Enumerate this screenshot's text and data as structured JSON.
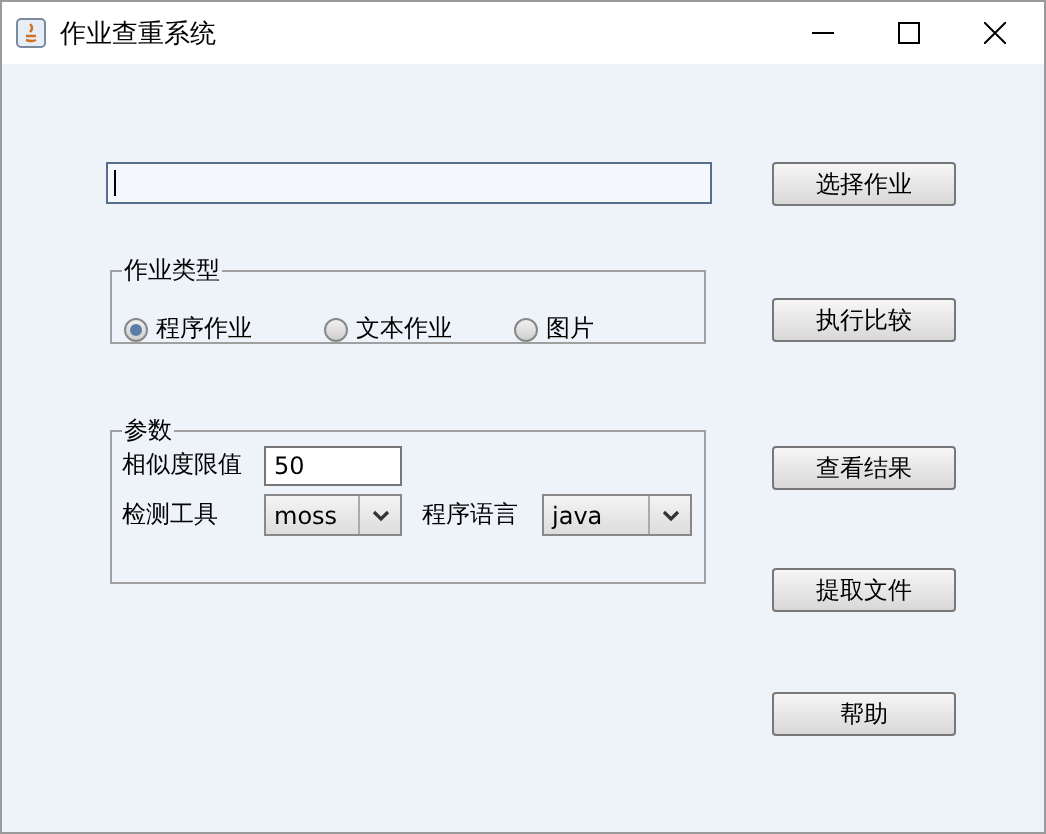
{
  "window": {
    "title": "作业查重系统"
  },
  "path_field": {
    "focused": true
  },
  "assignment_type": {
    "title": "作业类型",
    "options": [
      {
        "label": "程序作业",
        "selected": true
      },
      {
        "label": "文本作业",
        "selected": false
      },
      {
        "label": "图片",
        "selected": false
      }
    ]
  },
  "parameters": {
    "title": "参数",
    "threshold": {
      "label": "相似度限值",
      "value": "50"
    },
    "tool": {
      "label": "检测工具",
      "value": "moss"
    },
    "language": {
      "label": "程序语言",
      "value": "java"
    }
  },
  "buttons": [
    "选择作业",
    "执行比较",
    "查看结果",
    "提取文件",
    "帮助"
  ]
}
